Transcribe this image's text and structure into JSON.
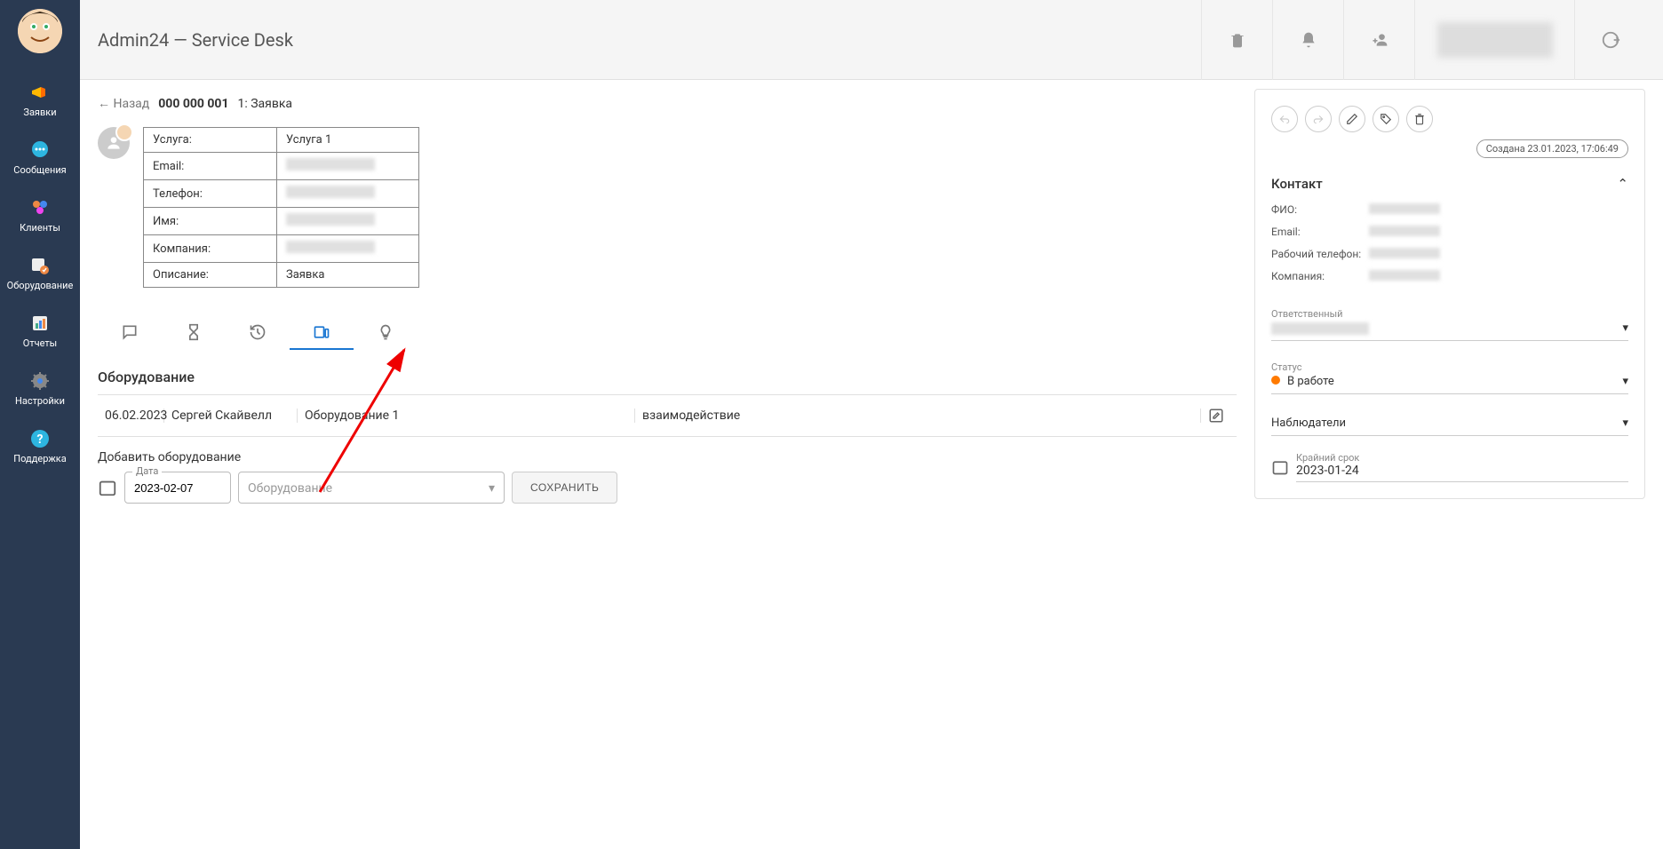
{
  "app_title": "Admin24 — Service Desk",
  "sidebar": {
    "items": [
      {
        "label": "Заявки",
        "icon": "megaphone"
      },
      {
        "label": "Сообщения",
        "icon": "chat"
      },
      {
        "label": "Клиенты",
        "icon": "people"
      },
      {
        "label": "Оборудование",
        "icon": "equipment"
      },
      {
        "label": "Отчеты",
        "icon": "reports"
      },
      {
        "label": "Настройки",
        "icon": "settings"
      },
      {
        "label": "Поддержка",
        "icon": "support"
      }
    ]
  },
  "breadcrumb": {
    "back": "← Назад",
    "ticket_id": "000 000 001",
    "ticket_title": "1: Заявка"
  },
  "info": {
    "rows": [
      {
        "label": "Услуга:",
        "value": "Услуга 1",
        "blurred": false
      },
      {
        "label": "Email:",
        "value": "",
        "blurred": true
      },
      {
        "label": "Телефон:",
        "value": "",
        "blurred": true
      },
      {
        "label": "Имя:",
        "value": "",
        "blurred": true
      },
      {
        "label": "Компания:",
        "value": "",
        "blurred": true
      },
      {
        "label": "Описание:",
        "value": "Заявка",
        "blurred": false
      }
    ]
  },
  "tabs": {
    "active_index": 3
  },
  "equipment": {
    "section_title": "Оборудование",
    "row": {
      "date": "06.02.2023",
      "user": "Сергей Скайвелл",
      "name": "Оборудование 1",
      "type": "взаимодействие"
    },
    "add_label": "Добавить оборудование",
    "date_label": "Дата",
    "date_value": "2023-02-07",
    "select_placeholder": "Оборудование",
    "save_label": "СОХРАНИТЬ"
  },
  "panel": {
    "created_label": "Создана 23.01.2023, 17:06:49",
    "contact_title": "Контакт",
    "contact": [
      {
        "label": "ФИО:"
      },
      {
        "label": "Email:"
      },
      {
        "label": "Рабочий телефон:"
      },
      {
        "label": "Компания:"
      }
    ],
    "responsible_label": "Ответственный",
    "status_label": "Статус",
    "status_value": "В работе",
    "status_color": "#ff7a00",
    "observers_label": "Наблюдатели",
    "deadline_label": "Крайний срок",
    "deadline_value": "2023-01-24"
  }
}
